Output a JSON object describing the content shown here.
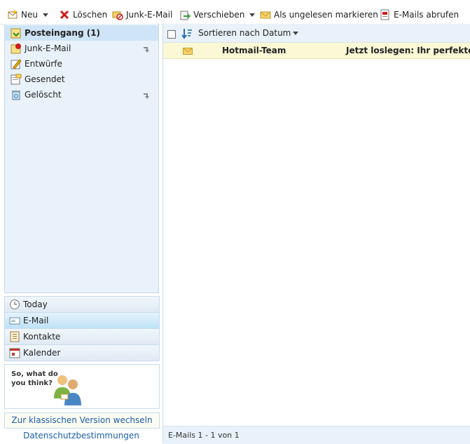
{
  "toolbar": {
    "new_label": "Neu",
    "delete_label": "Löschen",
    "junk_label": "Junk-E-Mail",
    "move_label": "Verschieben",
    "mark_unread_label": "Als ungelesen markieren",
    "fetch_label": "E-Mails abrufen"
  },
  "folders": [
    {
      "label": "Posteingang (1)",
      "icon": "inbox-icon",
      "selected": true
    },
    {
      "label": "Junk-E-Mail",
      "icon": "junk-folder-icon"
    },
    {
      "label": "Entwürfe",
      "icon": "drafts-icon"
    },
    {
      "label": "Gesendet",
      "icon": "sent-icon"
    },
    {
      "label": "Gelöscht",
      "icon": "deleted-icon"
    }
  ],
  "nav": [
    {
      "label": "Today",
      "icon": "clock-icon"
    },
    {
      "label": "E-Mail",
      "icon": "mail-icon",
      "active": true
    },
    {
      "label": "Kontakte",
      "icon": "contacts-icon"
    },
    {
      "label": "Kalender",
      "icon": "calendar-icon"
    }
  ],
  "feedback": {
    "text": "So, what do you think?"
  },
  "footer": {
    "classic_link": "Zur klassischen Version wechseln",
    "privacy_link": "Datenschutzbestimmungen"
  },
  "list": {
    "sort_label": "Sortieren nach Datum",
    "messages": [
      {
        "from": "Hotmail-Team",
        "subject": "Jetzt loslegen: Ihr perfekte",
        "unread": true
      }
    ],
    "status": "E-Mails 1 - 1 von 1"
  },
  "colors": {
    "accent": "#1a5fa7",
    "sidebar_bg": "#e9f2fa",
    "unread_row": "#fbf8d6"
  }
}
